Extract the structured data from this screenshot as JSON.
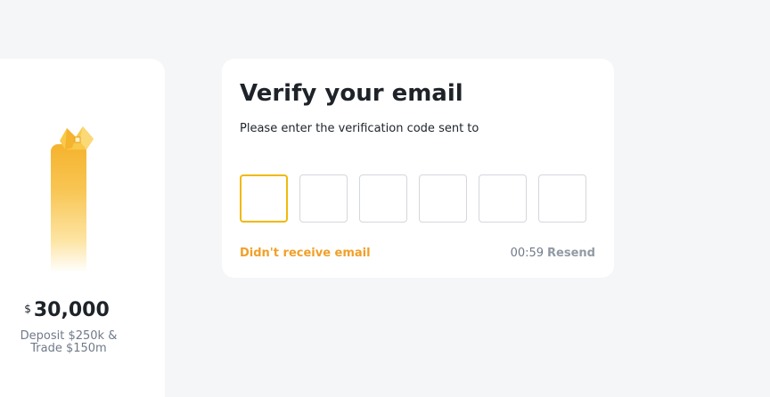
{
  "tier": {
    "currency_symbol": "$",
    "amount": "30,000",
    "description_line1": "Deposit $250k &",
    "description_line2": "Trade $150m",
    "accent_color": "#f5b32e"
  },
  "verify": {
    "title": "Verify your email",
    "subtitle": "Please enter the verification code sent to",
    "code_digits": [
      "",
      "",
      "",
      "",
      "",
      ""
    ],
    "active_digit_index": 0,
    "active_border_color": "#f0b90b",
    "help_link": "Didn't receive email",
    "help_link_color": "#f0a028",
    "timer": "00:59",
    "resend_label": "Resend"
  }
}
